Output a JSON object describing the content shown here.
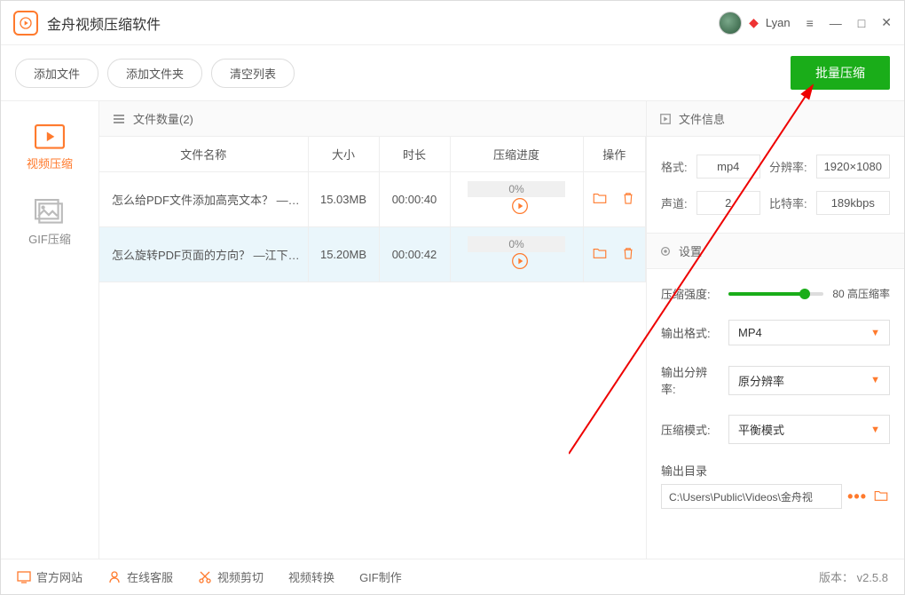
{
  "title": "金舟视频压缩软件",
  "user": {
    "name": "Lyan"
  },
  "toolbar": {
    "add_file": "添加文件",
    "add_folder": "添加文件夹",
    "clear_list": "清空列表",
    "batch_compress": "批量压缩"
  },
  "sidebar": {
    "video": "视频压缩",
    "gif": "GIF压缩"
  },
  "list": {
    "header": "文件数量(2)",
    "cols": {
      "name": "文件名称",
      "size": "大小",
      "duration": "时长",
      "progress": "压缩进度",
      "ops": "操作"
    },
    "rows": [
      {
        "name": "怎么给PDF文件添加高亮文本？ —…",
        "size": "15.03MB",
        "duration": "00:00:40",
        "progress": "0%"
      },
      {
        "name": "怎么旋转PDF页面的方向？ —江下…",
        "size": "15.20MB",
        "duration": "00:00:42",
        "progress": "0%"
      }
    ]
  },
  "info": {
    "header": "文件信息",
    "labels": {
      "format": "格式:",
      "resolution": "分辨率:",
      "channels": "声道:",
      "bitrate": "比特率:"
    },
    "format": "mp4",
    "resolution": "1920×1080",
    "channels": "2",
    "bitrate": "189kbps"
  },
  "settings": {
    "header": "设置",
    "labels": {
      "strength": "压缩强度:",
      "strength_val": "80 高压缩率",
      "out_format": "输出格式:",
      "out_res": "输出分辨率:",
      "mode": "压缩模式:",
      "out_dir": "输出目录"
    },
    "out_format": "MP4",
    "out_res": "原分辨率",
    "mode": "平衡模式",
    "out_dir": "C:\\Users\\Public\\Videos\\金舟视"
  },
  "footer": {
    "site": "官方网站",
    "support": "在线客服",
    "cut": "视频剪切",
    "convert": "视频转换",
    "gif": "GIF制作",
    "version": "版本： v2.5.8"
  }
}
